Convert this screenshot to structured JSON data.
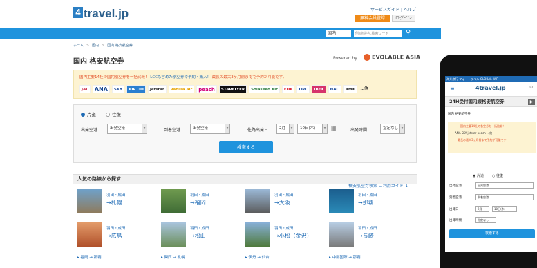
{
  "header": {
    "logo_four": "4",
    "logo_text": "travel.jp",
    "links": [
      "サービスガイド",
      "ヘルプ"
    ],
    "register_label": "無料会員登録",
    "login_label": "ログイン"
  },
  "searchbar": {
    "select_value": "国内",
    "input_placeholder": "例)施設名,検索ワード",
    "search_icon": "search-icon"
  },
  "breadcrumb": [
    "ホーム",
    "国内",
    "国内 格安航空券"
  ],
  "page_title": "国内 格安航空券",
  "powered_by": "Powered by",
  "partner": "EVOLABLE ASIA",
  "promo": {
    "text_main": "国内主要14社の国内航空券を一括比較！",
    "text_blue": "LCCも含めた航空券で予約・購入！",
    "text_end": "最長の最大3ヶ月前までで予約が可能です。",
    "airlines": [
      "JAL",
      "ANA",
      "SKY",
      "AIR DO",
      "Jetstar",
      "Vanilla Air",
      "peach",
      "STARFLYER",
      "Solaseed Air",
      "FDA",
      "ORC",
      "IBEX",
      "HAC",
      "AMX",
      "…他"
    ]
  },
  "search": {
    "oneway_label": "片道",
    "roundtrip_label": "往復",
    "from_label": "出発空港",
    "from_value": "出発空港",
    "to_label": "到着空港",
    "to_value": "出発空港",
    "date_label": "往路出発日",
    "month_value": "2月",
    "day_value": "10日(木)",
    "time_label": "出発時間",
    "time_value": "指定なし",
    "button_label": "検索する"
  },
  "guide_link": "格安航空券検索 ご利用ガイド",
  "popular": {
    "title": "人気の路線から探す",
    "routes": [
      {
        "from": "羽田・成田",
        "to": "→札幌"
      },
      {
        "from": "羽田・成田",
        "to": "→福岡"
      },
      {
        "from": "羽田・成田",
        "to": "→大阪"
      },
      {
        "from": "羽田・成田",
        "to": "→那覇"
      },
      {
        "from": "羽田・成田",
        "to": "→広島"
      },
      {
        "from": "羽田・成田",
        "to": "→松山"
      },
      {
        "from": "羽田・成田",
        "to": "→小松（金沢）"
      },
      {
        "from": "羽田・成田",
        "to": "→長崎"
      }
    ],
    "bottom_links": [
      "福岡 → 那覇",
      "関西 → 札幌",
      "伊丹 → 仙台",
      "中部国際 → 那覇"
    ]
  },
  "phone": {
    "topbar": "海外旅行 フォートラベル GLOBAL WiFi",
    "logo": "4travel.jp",
    "banner": "24H受付国内線格安航空券",
    "sub": "国内 格安航空券",
    "promo_line1": "国内主要14社の各空券を一括比較！",
    "promo_line2": "ANA SKY jetstar peach …他",
    "promo_line3": "最長の最大3ヶ月前まで予約が可能です",
    "oneway": "片道",
    "roundtrip": "往復",
    "from_label": "出発空港",
    "from_value": "出発空港",
    "to_label": "到着空港",
    "to_value": "到着空港",
    "date_label": "出発日",
    "month": "2月",
    "day": "10日(木)",
    "time_label": "出発時間",
    "time_value": "指定なし",
    "button": "検索する"
  },
  "colors": {
    "accent": "#1f93dd",
    "orange": "#ef8a17",
    "promo_bg": "#fdf3d2"
  }
}
